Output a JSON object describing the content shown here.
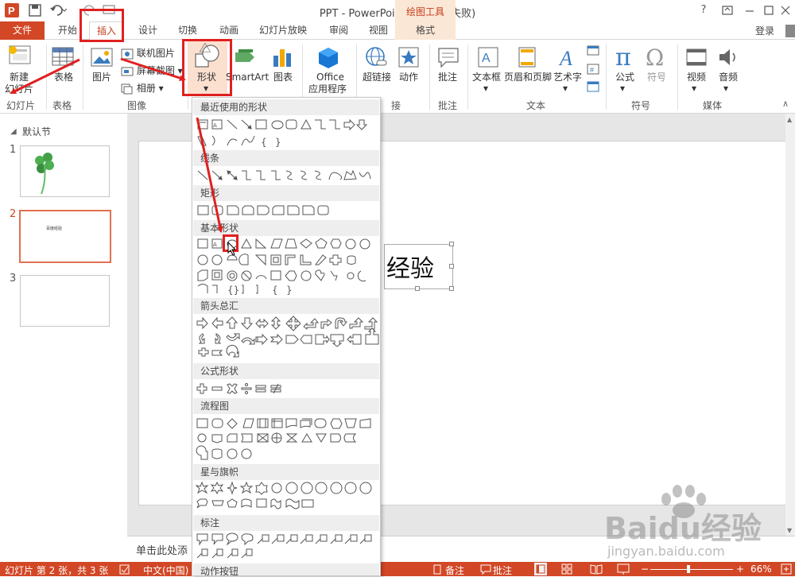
{
  "title_bar": {
    "title": "PPT - PowerPoint(产品激活失败)",
    "context_group": "绘图工具",
    "help": "?"
  },
  "tabs": [
    "开始",
    "插入",
    "设计",
    "切换",
    "动画",
    "幻灯片放映",
    "审阅",
    "视图",
    "格式"
  ],
  "file_tab": "文件",
  "login": "登录",
  "ribbon": {
    "new_slide": [
      "新建",
      "幻灯片"
    ],
    "table": "表格",
    "picture": "图片",
    "online_picture": "联机图片",
    "screenshot": "屏幕截图",
    "album": "相册",
    "shapes": "形状",
    "smartart": "SmartArt",
    "chart": "图表",
    "office_apps": [
      "Office",
      "应用程序"
    ],
    "hyperlink": "超链接",
    "action": "动作",
    "comment": "批注",
    "textbox": "文本框",
    "header_footer": "页眉和页脚",
    "wordart": "艺术字",
    "equation": "公式",
    "symbol": "符号",
    "video": "视频",
    "audio": "音频",
    "groups": {
      "slides": "幻灯片",
      "tables": "表格",
      "images": "图像",
      "links": "接",
      "comments": "批注",
      "text": "文本",
      "symbols": "符号",
      "media": "媒体"
    }
  },
  "left_pane": {
    "section": "默认节",
    "slides": [
      {
        "num": "1"
      },
      {
        "num": "2",
        "text": "百度经验"
      },
      {
        "num": "3"
      }
    ]
  },
  "slide": {
    "textbox_text": "经验"
  },
  "notes_placeholder": "单击此处添",
  "status": {
    "slide_info": "幻灯片 第 2 张，共 3 张",
    "language": "中文(中国)",
    "notes": "备注",
    "comments": "批注",
    "zoom": "66%"
  },
  "shape_menu": {
    "categories": [
      "最近使用的形状",
      "线条",
      "矩形",
      "基本形状",
      "箭头总汇",
      "公式形状",
      "流程图",
      "星与旗帜",
      "标注",
      "动作按钮"
    ]
  },
  "watermark": {
    "brand": "Baidu",
    "cn": "经验",
    "url": "jingyan.baidu.com"
  },
  "colors": {
    "accent": "#d24726",
    "annotation": "#e02020",
    "context": "#fbe7d6"
  }
}
